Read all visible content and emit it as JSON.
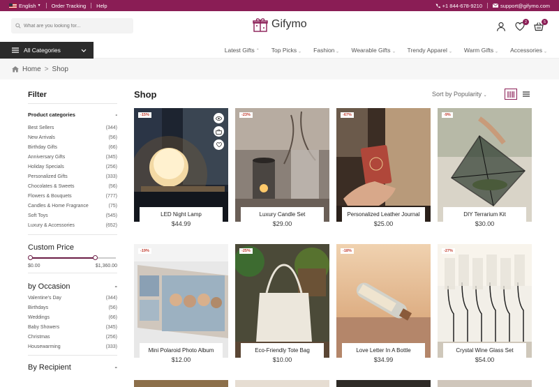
{
  "topbar": {
    "language": "English",
    "order_tracking": "Order Tracking",
    "help": "Help",
    "phone": "+1 844-678-9210",
    "email": "support@gifymo.com"
  },
  "header": {
    "search_placeholder": "What are you looking for...",
    "logo": "Gifymo",
    "wishlist_count": "2",
    "cart_count": "5"
  },
  "nav": {
    "all_categories": "All Categories",
    "items": [
      "Latest Gifts",
      "Top Picks",
      "Fashion",
      "Wearable Gifts",
      "Trendy Apparel",
      "Warm Gifts",
      "Accessories"
    ]
  },
  "breadcrumb": {
    "home": "Home",
    "sep": ">",
    "current": "Shop"
  },
  "filter": {
    "title": "Filter",
    "product_categories": {
      "title": "Product categories",
      "collapse": "-",
      "items": [
        {
          "name": "Best Sellers",
          "count": "(344)"
        },
        {
          "name": "New Arrivals",
          "count": "(56)"
        },
        {
          "name": "Birthday Gifts",
          "count": "(66)"
        },
        {
          "name": "Anniversary Gifts",
          "count": "(345)"
        },
        {
          "name": "Holiday Specials",
          "count": "(256)"
        },
        {
          "name": "Personalized Gifts",
          "count": "(333)"
        },
        {
          "name": "Chocolates & Sweets",
          "count": "(56)"
        },
        {
          "name": "Flowers & Bouquets",
          "count": "(777)"
        },
        {
          "name": "Candles & Home Fragrance",
          "count": "(75)"
        },
        {
          "name": "Soft Toys",
          "count": "(545)"
        },
        {
          "name": "Luxury & Accessories",
          "count": "(652)"
        }
      ]
    },
    "custom_price": {
      "title": "Custom Price",
      "min": "$0.00",
      "max": "$1,360.00"
    },
    "occasion": {
      "title": "by Occasion",
      "collapse": "-",
      "items": [
        {
          "name": "Valentine's Day",
          "count": "(344)"
        },
        {
          "name": "Birthdays",
          "count": "(56)"
        },
        {
          "name": "Weddings",
          "count": "(66)"
        },
        {
          "name": "Baby Showers",
          "count": "(345)"
        },
        {
          "name": "Christmas",
          "count": "(256)"
        },
        {
          "name": "Housewarming",
          "count": "(333)"
        }
      ]
    },
    "recipient": {
      "title": "By Recipient",
      "collapse": "-"
    }
  },
  "shop": {
    "title": "Shop",
    "sort": "Sort by Popularity"
  },
  "products": [
    {
      "name": "LED Night Lamp",
      "price": "$44.99",
      "discount": "-15%"
    },
    {
      "name": "Luxury Candle Set",
      "price": "$29.00",
      "discount": "-23%"
    },
    {
      "name": "Personalized Leather Journal",
      "price": "$25.00",
      "discount": "-67%"
    },
    {
      "name": "DIY Terrarium Kit",
      "price": "$30.00",
      "discount": "-9%"
    },
    {
      "name": "Mini Polaroid Photo Album",
      "price": "$12.00",
      "discount": "-19%"
    },
    {
      "name": "Eco-Friendly Tote Bag",
      "price": "$10.00",
      "discount": "-25%"
    },
    {
      "name": "Love Letter In A Bottle",
      "price": "$34.99",
      "discount": "-18%"
    },
    {
      "name": "Crystal Wine Glass Set",
      "price": "$54.00",
      "discount": "-27%"
    }
  ],
  "colors": {
    "brand": "#8a1d55",
    "dark": "#2b2b2b"
  }
}
